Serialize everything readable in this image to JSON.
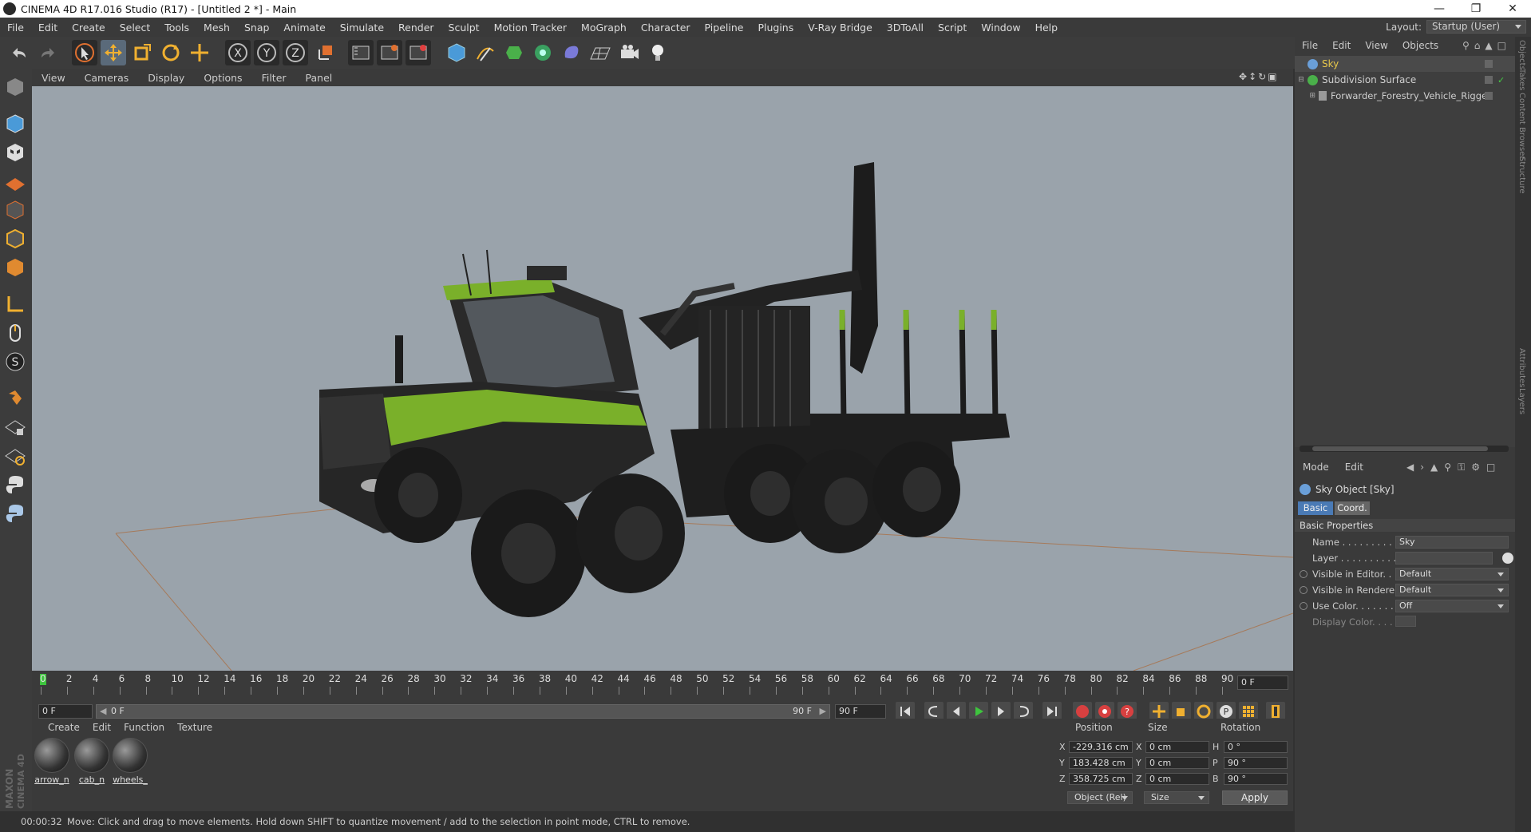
{
  "window": {
    "title": "CINEMA 4D R17.016 Studio (R17) - [Untitled 2 *] - Main",
    "min_icon": "minimize-icon",
    "max_icon": "restore-icon",
    "close_icon": "close-icon"
  },
  "menubar": [
    "File",
    "Edit",
    "Create",
    "Select",
    "Tools",
    "Mesh",
    "Snap",
    "Animate",
    "Simulate",
    "Render",
    "Sculpt",
    "Motion Tracker",
    "MoGraph",
    "Character",
    "Pipeline",
    "Plugins",
    "V-Ray Bridge",
    "3DToAll",
    "Script",
    "Window",
    "Help"
  ],
  "layout": {
    "label": "Layout:",
    "value": "Startup (User)"
  },
  "viewport_menu": [
    "View",
    "Cameras",
    "Display",
    "Options",
    "Filter",
    "Panel"
  ],
  "timeline": {
    "ticks": [
      "0",
      "2",
      "4",
      "6",
      "8",
      "10",
      "12",
      "14",
      "16",
      "18",
      "20",
      "22",
      "24",
      "26",
      "28",
      "30",
      "32",
      "34",
      "36",
      "38",
      "40",
      "42",
      "44",
      "46",
      "48",
      "50",
      "52",
      "54",
      "56",
      "58",
      "60",
      "62",
      "64",
      "66",
      "68",
      "70",
      "72",
      "74",
      "76",
      "78",
      "80",
      "82",
      "84",
      "86",
      "88",
      "90"
    ],
    "current_frame": "0 F",
    "start_frame": "0 F",
    "range_start": "0 F",
    "range_end": "90 F",
    "end_frame": "90 F"
  },
  "material_menu": [
    "Create",
    "Edit",
    "Function",
    "Texture"
  ],
  "materials": [
    "arrow_n",
    "cab_n",
    "wheels_"
  ],
  "coords": {
    "headers": {
      "position": "Position",
      "size": "Size",
      "rotation": "Rotation"
    },
    "rows": [
      {
        "axis": "X",
        "pos": "-229.316 cm",
        "size_axis": "X",
        "size": "0 cm",
        "rot_axis": "H",
        "rot": "0 °"
      },
      {
        "axis": "Y",
        "pos": "183.428 cm",
        "size_axis": "Y",
        "size": "0 cm",
        "rot_axis": "P",
        "rot": "90 °"
      },
      {
        "axis": "Z",
        "pos": "358.725 cm",
        "size_axis": "Z",
        "size": "0 cm",
        "rot_axis": "B",
        "rot": "90 °"
      }
    ],
    "mode": "Object (Rel)",
    "size_mode": "Size",
    "apply": "Apply"
  },
  "status": {
    "time": "00:00:32",
    "message": "Move: Click and drag to move elements. Hold down SHIFT to quantize movement / add to the selection in point mode, CTRL to remove."
  },
  "objects_menu": [
    "File",
    "Edit",
    "View",
    "Objects"
  ],
  "objects": [
    {
      "name": "Sky",
      "color": "#e8c84a",
      "icon_color": "#6a9fd8"
    },
    {
      "name": "Subdivision Surface",
      "color": "#cfcfcf",
      "icon_color": "#4ab04a"
    },
    {
      "name": "Forwarder_Forestry_Vehicle_Rigged",
      "color": "#cfcfcf",
      "icon_color": "#999999"
    }
  ],
  "attributes": {
    "menu": [
      "Mode",
      "Edit"
    ],
    "object_title": "Sky Object [Sky]",
    "tabs": [
      "Basic",
      "Coord."
    ],
    "section": "Basic Properties",
    "props": [
      {
        "label": "Name . . . . . . . . . . . .",
        "value": "Sky"
      },
      {
        "label": "Layer . . . . . . . . . . . .",
        "value": ""
      },
      {
        "label": "Visible in Editor. . .",
        "value": "Default"
      },
      {
        "label": "Visible in Renderer",
        "value": "Default"
      },
      {
        "label": "Use Color. . . . . . . .",
        "value": "Off"
      },
      {
        "label": "Display Color. . . .",
        "value": ""
      }
    ]
  },
  "side_tabs": [
    "Objects",
    "Takes",
    "Content Browser",
    "Structure",
    "Attributes",
    "Layers"
  ],
  "brand": "MAXON CINEMA 4D",
  "colors": {
    "accent_green": "#8dc63f",
    "viewport_bg": "#9aa3ab",
    "selected_yellow": "#e8c84a",
    "tab_active": "#4a7ab5"
  }
}
